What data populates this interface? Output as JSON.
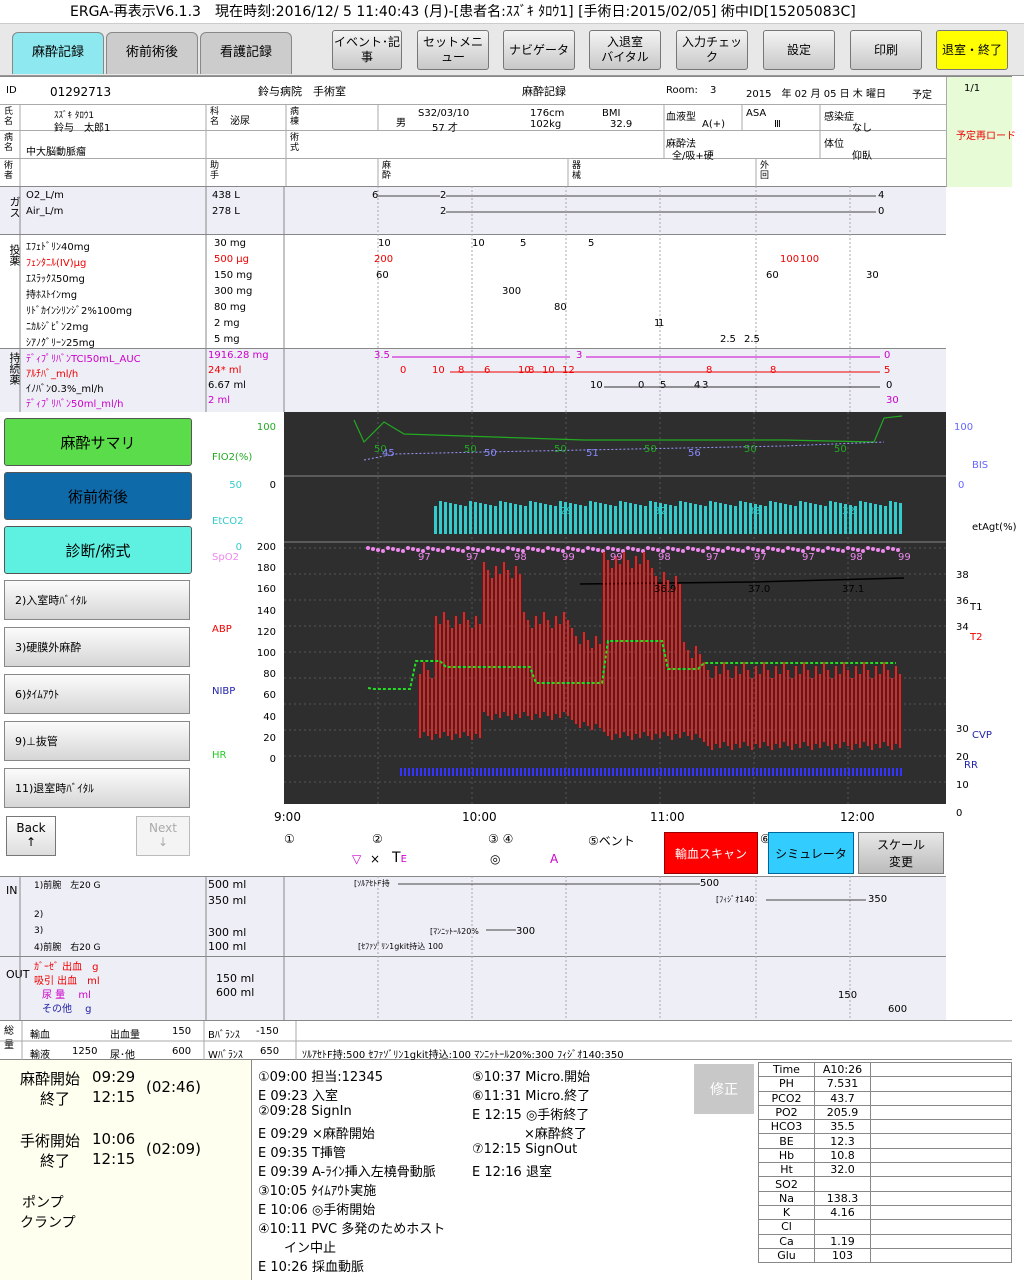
{
  "title": "ERGA-再表示V6.1.3　現在時刻:2016/12/ 5 11:40:43 (月)-[患者名:ｽｽﾞｷ ﾀﾛｳ1]  [手術日:2015/02/05]  術中ID[15205083C]",
  "tabs": [
    "麻酔記録",
    "術前術後",
    "看護記録"
  ],
  "toolbar": {
    "event": "イベント･記事",
    "set": "セットメニュー",
    "navi": "ナビゲータ",
    "inout1": "入退室",
    "inout2": "バイタル",
    "input": "入力チェック",
    "settings": "設定",
    "print": "印刷",
    "exit": "退室・終了"
  },
  "header": {
    "id_label": "ID",
    "id": "01292713",
    "hospital": "鈴与病院　手術室",
    "record": "麻酔記録",
    "room_label": "Room:",
    "room": "3",
    "date": "2015　年 02 月 05 日 木 曜日",
    "plan": "予定",
    "page": "1/1",
    "name_label": "氏名",
    "kana": "ｽｽﾞｷ ﾀﾛｳ1",
    "name": "鈴与　太郎1",
    "dept_label": "科名",
    "dept": "泌尿",
    "ward_label": "病棟",
    "sex": "男",
    "birth": "S32/03/10",
    "age": "57 才",
    "height": "176cm",
    "weight": "102kg",
    "bmi_label": "BMI",
    "bmi": "32.9",
    "blood_label": "血液型",
    "blood": "A(+)",
    "asa_label": "ASA",
    "asa": "Ⅲ",
    "infect_label": "感染症",
    "infect": "なし",
    "reload": "予定再ロード",
    "disease_label": "病名",
    "disease": "中大脳動脈瘤",
    "op_label": "術式",
    "method_label": "麻酔法",
    "method": "全/吸+硬",
    "pos_label": "体位",
    "pos": "仰臥",
    "surgeon_label": "術者",
    "assist_label": "助手",
    "anes_label": "麻酔",
    "instr_label": "器械",
    "circ_label": "外回"
  },
  "gas": {
    "label": "ガス",
    "rows": [
      {
        "name": "O2_L/m",
        "total": "438 L"
      },
      {
        "name": "Air_L/m",
        "total": "278 L"
      }
    ],
    "o2_vals": [
      "6",
      "2",
      "4"
    ],
    "air_vals": [
      "2",
      "0"
    ]
  },
  "drugs": {
    "label": "投薬",
    "rows": [
      {
        "name": "ｴﾌｪﾄﾞﾘﾝ40mg",
        "total": "30 mg",
        "vals": [
          "10",
          "10",
          "5",
          "5"
        ],
        "red": false
      },
      {
        "name": "ﾌｪﾝﾀﾆﾙ(IV)μg",
        "total": "500 μg",
        "vals": [
          "200",
          "100",
          "100"
        ],
        "red": true
      },
      {
        "name": "ｴｽﾗｯｸｽ50mg",
        "total": "150 mg",
        "vals": [
          "60",
          "60",
          "30"
        ],
        "red": false
      },
      {
        "name": "持ﾎｽﾄｲﾝmg",
        "total": "300 mg",
        "vals": [
          "300"
        ],
        "red": false
      },
      {
        "name": "ﾘﾄﾞｶｲﾝｼﾘﾝｼﾞ2%100mg",
        "total": "80 mg",
        "vals": [
          "80"
        ],
        "red": false
      },
      {
        "name": "ﾆｶﾙｼﾞﾋﾟﾝ2mg",
        "total": "2 mg",
        "vals": [
          "1",
          "1"
        ],
        "red": false
      },
      {
        "name": "ｼｱﾉｸﾞﾘｰﾝ25mg",
        "total": "5 mg",
        "vals": [
          "2.5",
          "2.5"
        ],
        "red": false
      }
    ]
  },
  "cont": {
    "label": "持続薬",
    "rows": [
      {
        "name": "ﾃﾞｨﾌﾟﾘﾊﾞﾝTCI50mL_AUC",
        "total": "1916.28 mg",
        "vals": [
          "3.5",
          "3",
          "0"
        ],
        "cls": "mag"
      },
      {
        "name": "ｱﾙﾁﾊﾞ_ml/h",
        "total": "24* ml",
        "vals": [
          "10",
          "8",
          "6",
          "10",
          "8",
          "10",
          "12",
          "8",
          "8",
          "5",
          "0"
        ],
        "cls": "red"
      },
      {
        "name": "ｲﾉﾊﾞﾝ0.3%_ml/h",
        "total": "6.67 ml",
        "vals": [
          "10",
          "0",
          "5",
          "4",
          "3",
          "0"
        ],
        "cls": ""
      },
      {
        "name": "ﾃﾞｨﾌﾟﾘﾊﾞﾝ50ml_ml/h",
        "total": "2 ml",
        "vals": [
          "30"
        ],
        "cls": "mag"
      }
    ]
  },
  "side": {
    "summary": "麻酔サマリ",
    "prepost": "術前術後",
    "diag": "診断/術式",
    "b2": "2)入室時ﾊﾞｲﾀﾙ",
    "b3": "3)硬膜外麻酔",
    "b6": "6)ﾀｲﾑｱｳﾄ",
    "b9": "9)⊥抜管",
    "b11": "11)退室時ﾊﾞｲﾀﾙ",
    "back": "Back",
    "back_arrow": "↑",
    "next": "Next",
    "next_arrow": "↓"
  },
  "chart_labels": {
    "fio2": "FIO2(%)",
    "etco2": "EtCO2",
    "spo2": "SpO2",
    "abp": "ABP",
    "nibp": "NIBP",
    "hr": "HR",
    "bis": "BIS",
    "etagt": "etAgt(%)",
    "t1": "T1",
    "t2": "T2",
    "cvp": "CVP",
    "rr": "RR"
  },
  "chart_data": {
    "type": "line",
    "x_ticks": [
      "9:00",
      "10:00",
      "11:00",
      "12:00"
    ],
    "y_left_ticks": [
      "200",
      "180",
      "160",
      "140",
      "120",
      "100",
      "80",
      "60",
      "40",
      "20",
      "0"
    ],
    "y_right_ticks": [
      "38",
      "36",
      "34",
      "30",
      "20",
      "10",
      "0"
    ],
    "fio2_ticks": [
      "100",
      "0"
    ],
    "etco2_ticks": [
      "50",
      "0"
    ],
    "bis_ticks": [
      "100",
      "0"
    ],
    "fio2_labels": [
      "50",
      "50",
      "50",
      "50",
      "50",
      "50"
    ],
    "bis_labels": [
      "45",
      "50",
      "51",
      "56"
    ],
    "etco2_labels": [
      "29",
      "32",
      "33",
      "32"
    ],
    "spo2_labels": [
      "97",
      "97",
      "98",
      "99",
      "99",
      "98",
      "97",
      "97",
      "97",
      "98",
      "99"
    ],
    "temp_labels": [
      "36.9",
      "37.0",
      "37.1"
    ],
    "series": [
      {
        "name": "HR",
        "color": "#22dd22"
      },
      {
        "name": "ABP",
        "color": "#ee2020"
      },
      {
        "name": "SpO2",
        "color": "#ee88ee"
      },
      {
        "name": "EtCO2",
        "color": "#33cccc"
      },
      {
        "name": "FIO2",
        "color": "#22aa22"
      },
      {
        "name": "BIS",
        "color": "#9999ff"
      }
    ]
  },
  "events": {
    "m1": "①",
    "m2": "②",
    "m34": "③ ④",
    "m5": "⑤ベント",
    "m6": "⑥",
    "sym1": "▽",
    "sym2": "×",
    "sym3": "T",
    "sym3b": "E",
    "sym4": "◎",
    "sym5": "A",
    "blood_scan": "輸血スキャン",
    "sim": "シミュレータ",
    "scale1": "スケール",
    "scale2": "変更"
  },
  "io": {
    "in_label": "IN",
    "out_label": "OUT",
    "in_rows": [
      {
        "name": "1)前腕　左20 G",
        "amount": "500 ml",
        "note": "[ｿﾙｱｾﾄF持",
        "val": "500"
      },
      {
        "name": "",
        "amount": "350 ml",
        "note": "[ﾌｨｼﾞｵ140",
        "val": "350"
      },
      {
        "name": "2)",
        "amount": "",
        "note": "",
        "val": ""
      },
      {
        "name": "3)",
        "amount": "300 ml",
        "note": "[ﾏﾝﾆｯﾄｰﾙ20%",
        "val": "300"
      },
      {
        "name": "4)前腕　右20 G",
        "amount": "100 ml",
        "note": "[ｾﾌｧｿﾞﾘﾝ1gkit持込 100",
        "val": ""
      }
    ],
    "out_rows": [
      {
        "name": "ｶﾞｰｾﾞ 出血　g",
        "amount": "",
        "val": ""
      },
      {
        "name": "吸引 出血　ml",
        "amount": "150 ml",
        "val": "150"
      },
      {
        "name": "尿 量　 ml",
        "amount": "600 ml",
        "val": "600"
      },
      {
        "name": "その他　 g",
        "amount": "",
        "val": ""
      }
    ]
  },
  "total": {
    "label": "総量",
    "trans": "輸血",
    "trans_v": "",
    "out": "出血量",
    "out_v": "150",
    "bal": "Bﾊﾞﾗﾝｽ",
    "bal_v": "-150",
    "fluid": "輸液",
    "fluid_v": "1250",
    "urine": "尿･他",
    "urine_v": "600",
    "wbal": "Wﾊﾞﾗﾝｽ",
    "wbal_v": "650",
    "summary": "ｿﾙｱｾﾄF持:500 ｾﾌｧｿﾞﾘﾝ1gkit持込:100 ﾏﾝﾆｯﾄｰﾙ20%:300 ﾌｨｼﾞｵ140:350"
  },
  "times": {
    "anes_start": "麻酔開始",
    "anes_start_t": "09:29",
    "end": "終了",
    "anes_end_t": "12:15",
    "anes_dur": "(02:46)",
    "op_start": "手術開始",
    "op_start_t": "10:06",
    "op_end_t": "12:15",
    "op_dur": "(02:09)",
    "pump": "ポンプ",
    "clamp": "クランプ"
  },
  "log_left": [
    "①09:00 担当:12345",
    "E 09:23 入室",
    "②09:28 SignIn",
    "E 09:29 ×麻酔開始",
    "E 09:35 T挿管",
    "E 09:39 A-ﾗｲﾝ挿入左橈骨動脈",
    "③10:05 ﾀｲﾑｱｳﾄ実施",
    "E 10:06 ◎手術開始",
    "④10:11 PVC 多発のためホスト",
    "　　イン中止",
    "E 10:26 採血動脈"
  ],
  "log_right": [
    "⑤10:37 Micro.開始",
    "⑥11:31 Micro.終了",
    "E 12:15 ◎手術終了",
    "　　　　×麻酔終了",
    "⑦12:15 SignOut",
    "E 12:16 退室"
  ],
  "fix": "修正",
  "lab": {
    "rows": [
      [
        "Time",
        "A10:26"
      ],
      [
        "PH",
        "7.531"
      ],
      [
        "PCO2",
        "43.7"
      ],
      [
        "PO2",
        "205.9"
      ],
      [
        "HCO3",
        "35.5"
      ],
      [
        "BE",
        "12.3"
      ],
      [
        "Hb",
        "10.8"
      ],
      [
        "Ht",
        "32.0"
      ],
      [
        "SO2",
        ""
      ],
      [
        "Na",
        "138.3"
      ],
      [
        "K",
        "4.16"
      ],
      [
        "Cl",
        ""
      ],
      [
        "Ca",
        "1.19"
      ],
      [
        "Glu",
        "103"
      ]
    ]
  }
}
